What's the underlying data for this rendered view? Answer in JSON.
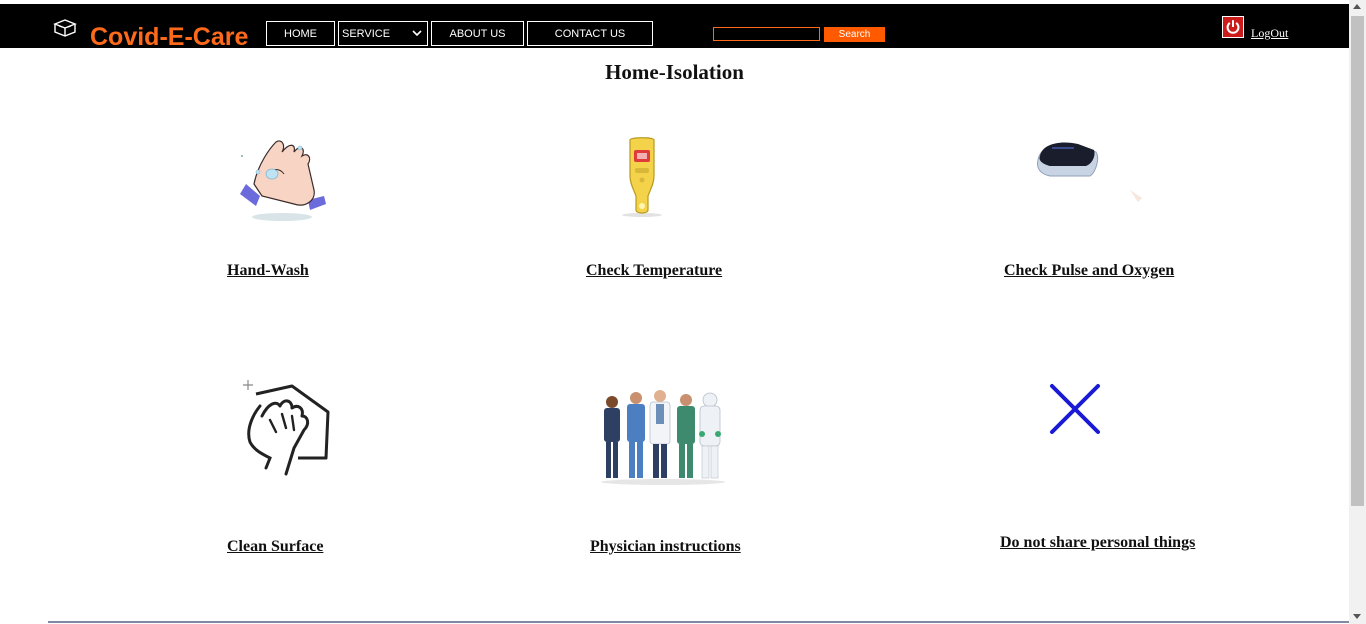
{
  "brand": {
    "name": "Covid-E-Care"
  },
  "nav": {
    "home": "HOME",
    "service": "SERVICE",
    "about": "ABOUT US",
    "contact": "CONTACT US"
  },
  "search": {
    "button": "Search",
    "placeholder": ""
  },
  "user": {
    "logout": "LogOut"
  },
  "page": {
    "title": "Home-Isolation"
  },
  "cards": [
    {
      "label": "Hand-Wash",
      "icon": "hand-wash-icon"
    },
    {
      "label": "Check Temperature",
      "icon": "thermometer-icon"
    },
    {
      "label": "Check Pulse and Oxygen",
      "icon": "pulse-oximeter-icon"
    },
    {
      "label": "Clean Surface",
      "icon": "wipe-surface-icon"
    },
    {
      "label": "Physician instructions",
      "icon": "physicians-icon"
    },
    {
      "label": "Do not share personal things",
      "icon": "cross-icon"
    }
  ],
  "colors": {
    "brand": "#ff6a1a",
    "navbar": "#000000",
    "search_button": "#ff5a00",
    "power": "#cc1b1b",
    "cross": "#1a1ad6"
  }
}
